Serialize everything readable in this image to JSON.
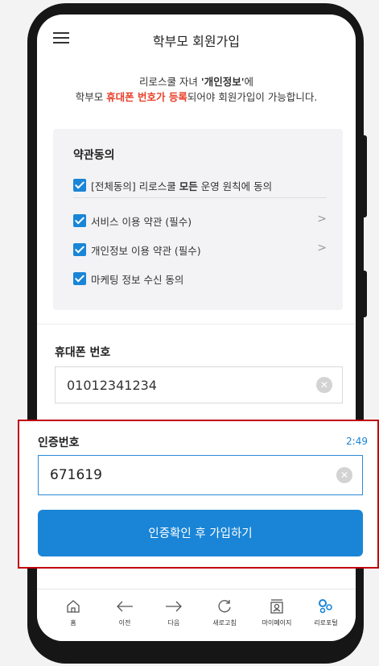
{
  "header": {
    "title": "학부모 회원가입",
    "menu_icon": "hamburger-menu-icon"
  },
  "notice": {
    "line1_pre": "리로스쿨 자녀 ",
    "line1_bold": "'개인정보'",
    "line1_post": "에",
    "line2_pre": "학부모 ",
    "line2_red": "휴대폰 번호가 등록",
    "line2_post": "되어야 회원가입이 가능합니다."
  },
  "terms": {
    "title": "약관동의",
    "agree_all_pre": "[전체동의] 리로스쿨 ",
    "agree_all_bold": "모든",
    "agree_all_post": " 운영 원칙에 동의",
    "items": [
      {
        "label": "서비스 이용 약관 (필수)",
        "checked": true,
        "has_detail": true
      },
      {
        "label": "개인정보 이용 약관 (필수)",
        "checked": true,
        "has_detail": true
      },
      {
        "label": "마케팅 정보 수신 동의",
        "checked": true,
        "has_detail": false
      }
    ],
    "chevron": ">"
  },
  "phone": {
    "label": "휴대폰 번호",
    "value": "01012341234"
  },
  "verification": {
    "label": "인증번호",
    "timer": "2:49",
    "value": "671619",
    "submit_label": "인증확인 후 가입하기"
  },
  "bottom_nav": [
    {
      "label": "홈",
      "icon": "home-icon"
    },
    {
      "label": "이전",
      "icon": "arrow-left-icon"
    },
    {
      "label": "다음",
      "icon": "arrow-right-icon"
    },
    {
      "label": "새로고침",
      "icon": "refresh-icon"
    },
    {
      "label": "마이페이지",
      "icon": "mypage-icon"
    },
    {
      "label": "리로포털",
      "icon": "portal-icon"
    }
  ],
  "colors": {
    "accent": "#1a85d6",
    "highlight_red": "#e8412c",
    "annotation_border": "#c0000c"
  }
}
